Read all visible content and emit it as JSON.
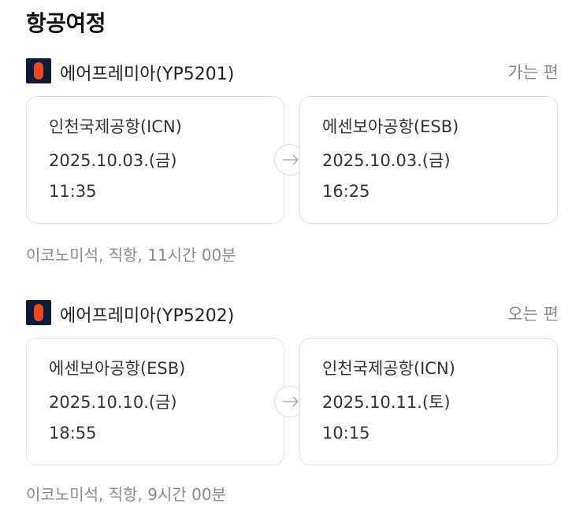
{
  "page_title": "항공여정",
  "legs": [
    {
      "airline": "에어프레미아(YP5201)",
      "direction": "가는 편",
      "departure": {
        "airport": "인천국제공항(ICN)",
        "date": "2025.10.03.(금)",
        "time": "11:35"
      },
      "arrival": {
        "airport": "에센보아공항(ESB)",
        "date": "2025.10.03.(금)",
        "time": "16:25"
      },
      "summary": "이코노미석, 직항, 11시간 00분"
    },
    {
      "airline": "에어프레미아(YP5202)",
      "direction": "오는 편",
      "departure": {
        "airport": "에센보아공항(ESB)",
        "date": "2025.10.10.(금)",
        "time": "18:55"
      },
      "arrival": {
        "airport": "인천국제공항(ICN)",
        "date": "2025.10.11.(토)",
        "time": "10:15"
      },
      "summary": "이코노미석, 직항, 9시간 00분"
    }
  ],
  "icons": {
    "airline_logo": "airline-logo-icon",
    "arrow": "arrow-right-icon"
  },
  "colors": {
    "logo_bg": "#0f1b3a",
    "logo_accent": "#ea4a1f",
    "muted_text": "#8a8a8a"
  }
}
